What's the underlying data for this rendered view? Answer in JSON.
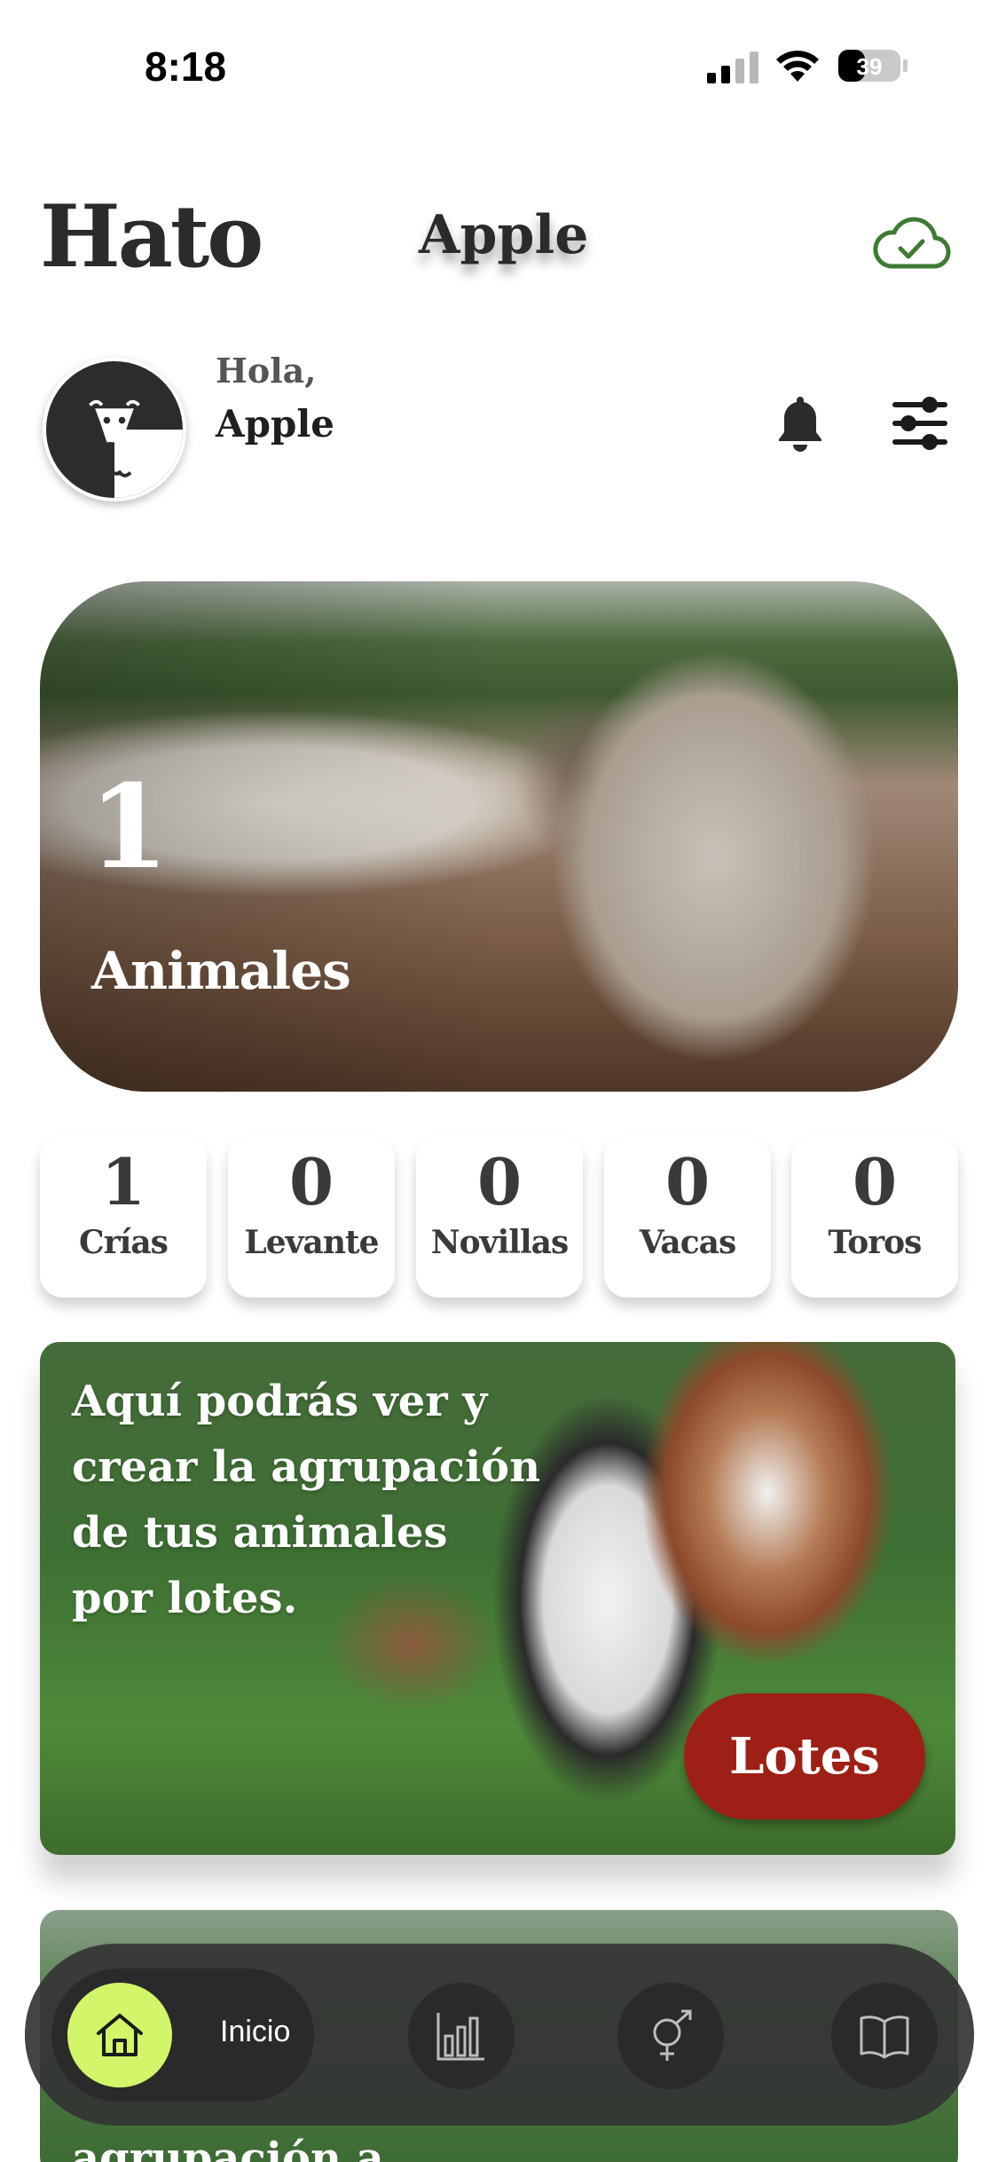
{
  "status_bar": {
    "time": "8:18",
    "battery": "39"
  },
  "header": {
    "title": "Hato",
    "user": "Apple",
    "sync_icon": "cloud-check-icon"
  },
  "greeting": {
    "hello": "Hola,",
    "name": "Apple",
    "avatar_icon": "cow-logo-icon",
    "notification_icon": "bell-icon",
    "filter_icon": "sliders-icon"
  },
  "hero": {
    "count": "1",
    "label": "Animales"
  },
  "categories": [
    {
      "count": "1",
      "label": "Crías"
    },
    {
      "count": "0",
      "label": "Levante"
    },
    {
      "count": "0",
      "label": "Novillas"
    },
    {
      "count": "0",
      "label": "Vacas"
    },
    {
      "count": "0",
      "label": "Toros"
    }
  ],
  "lotes_card": {
    "line1": "Aquí podrás ver y",
    "line2": "crear la agrupación",
    "line3": "de tus animales",
    "line4": "por lotes.",
    "button": "Lotes"
  },
  "next_card": {
    "text": "agrupación a"
  },
  "bottom_nav": {
    "home_label": "Inicio",
    "items": [
      "home-icon",
      "bar-chart-icon",
      "gender-icon",
      "book-icon"
    ],
    "accent": "#d3f56a"
  },
  "colors": {
    "lotes_button": "#9e1f16",
    "cloud_check": "#3f7a35"
  }
}
